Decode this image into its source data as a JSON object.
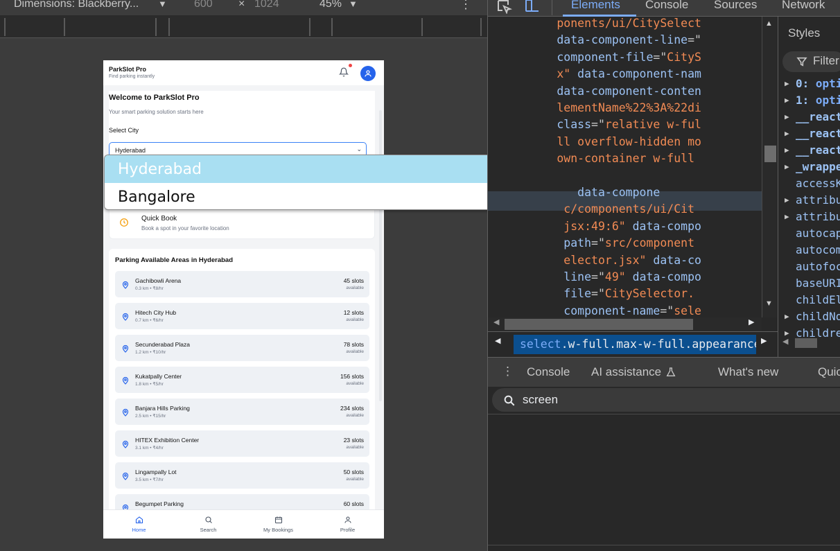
{
  "device_toolbar": {
    "dimensions_label": "Dimensions: Blackberry...",
    "width": "600",
    "times": "×",
    "height": "1024",
    "zoom": "45%"
  },
  "app": {
    "title": "ParkSlot Pro",
    "subtitle": "Find parking instantly",
    "welcome_heading": "Welcome to ParkSlot Pro",
    "welcome_text": "Your smart parking solution starts here",
    "select_city_label": "Select City",
    "selected_city": "Hyderabad",
    "quick_book": {
      "title": "Quick Book",
      "desc": "Book a spot in your favorite location"
    },
    "areas_heading": "Parking Available Areas in Hyderabad",
    "areas": [
      {
        "name": "Gachibowli Arena",
        "meta": "0.3 km • ₹8/hr",
        "slots": "45 slots",
        "avail": "available"
      },
      {
        "name": "Hitech City Hub",
        "meta": "0.7 km • ₹6/hr",
        "slots": "12 slots",
        "avail": "available"
      },
      {
        "name": "Secunderabad Plaza",
        "meta": "1.2 km • ₹10/hr",
        "slots": "78 slots",
        "avail": "available"
      },
      {
        "name": "Kukatpally Center",
        "meta": "1.8 km • ₹5/hr",
        "slots": "156 slots",
        "avail": "available"
      },
      {
        "name": "Banjara Hills Parking",
        "meta": "2.5 km • ₹15/hr",
        "slots": "234 slots",
        "avail": "available"
      },
      {
        "name": "HITEX Exhibition Center",
        "meta": "3.1 km • ₹4/hr",
        "slots": "23 slots",
        "avail": "available"
      },
      {
        "name": "Lingampally Lot",
        "meta": "3.5 km • ₹7/hr",
        "slots": "50 slots",
        "avail": "available"
      },
      {
        "name": "Begumpet Parking",
        "meta": "",
        "slots": "60 slots",
        "avail": ""
      }
    ],
    "nav": {
      "home": "Home",
      "search": "Search",
      "bookings": "My Bookings",
      "profile": "Profile"
    }
  },
  "dropdown_options": [
    "Hyderabad",
    "Bangalore"
  ],
  "devtools": {
    "tabs": {
      "elements": "Elements",
      "console": "Console",
      "sources": "Sources",
      "network": "Network"
    },
    "code_lines": [
      {
        "attr": "",
        "eq": "",
        "val": "ponents/ui/CitySelect",
        "indent": "          "
      },
      {
        "attr": "data-component-line",
        "eq": "=\"",
        "val": "",
        "indent": "          "
      },
      {
        "attr": "component-file",
        "eq": "=\"",
        "val": "CityS",
        "indent": "          "
      },
      {
        "attr": "",
        "eq": "",
        "val": "x\"",
        "tail": " data-component-nam",
        "indent": "          "
      },
      {
        "attr": "data-component-conten",
        "eq": "",
        "val": "",
        "indent": "          "
      },
      {
        "attr": "",
        "eq": "",
        "val": "lementName%22%3A%22di",
        "indent": "          "
      },
      {
        "attr": "class",
        "eq": "=\"",
        "val": "relative w-ful",
        "indent": "          "
      },
      {
        "attr": "",
        "eq": "",
        "val": "ll overflow-hidden mo",
        "indent": "          "
      },
      {
        "attr": "",
        "eq": "",
        "val": "own-container w-full ",
        "indent": "          "
      },
      {
        "attr": "",
        "eq": "",
        "val": "",
        "indent": "          "
      },
      {
        "attr": "data-compone",
        "eq": "",
        "val": "",
        "indent": "             "
      },
      {
        "attr": "",
        "eq": "",
        "val": "c/components/ui/Cit",
        "indent": "           "
      },
      {
        "attr": "",
        "eq": "",
        "val": "jsx:49:6\"",
        "tail": " data-compo",
        "indent": "           "
      },
      {
        "attr": "path",
        "eq": "=\"",
        "val": "src/component",
        "indent": "           "
      },
      {
        "attr": "",
        "eq": "",
        "val": "elector.jsx\"",
        "tail": " data-co",
        "indent": "           "
      },
      {
        "attr": "line",
        "eq": "=\"",
        "val": "49\"",
        "tail": " data-compo",
        "indent": "           "
      },
      {
        "attr": "file",
        "eq": "=\"",
        "val": "CitySelector.",
        "indent": "           "
      },
      {
        "attr": "component-name",
        "eq": "=\"",
        "val": "sele",
        "indent": "           "
      }
    ],
    "breadcrumb": {
      "tag": "select",
      "classes": ".w-full.max-w-full.appearance-none.b"
    },
    "styles_tab": "Styles",
    "filter_placeholder": "Filter",
    "props": [
      {
        "key": "0:",
        "val": " opti",
        "bold": true,
        "arrow": true
      },
      {
        "key": "1:",
        "val": " opti",
        "bold": true,
        "arrow": true
      },
      {
        "key": "__react",
        "val": "",
        "bold": true,
        "arrow": true
      },
      {
        "key": "__react",
        "val": "",
        "bold": true,
        "arrow": true
      },
      {
        "key": "__react",
        "val": "",
        "bold": true,
        "arrow": true
      },
      {
        "key": "_wrappe",
        "val": "",
        "bold": true,
        "arrow": true
      },
      {
        "key": "accessK",
        "val": "",
        "bold": false,
        "arrow": false
      },
      {
        "key": "attribu",
        "val": "",
        "bold": false,
        "arrow": true
      },
      {
        "key": "attribu",
        "val": "",
        "bold": false,
        "arrow": true
      },
      {
        "key": "autocap",
        "val": "",
        "bold": false,
        "arrow": false
      },
      {
        "key": "autocom",
        "val": "",
        "bold": false,
        "arrow": false
      },
      {
        "key": "autofoc",
        "val": "",
        "bold": false,
        "arrow": false
      },
      {
        "key": "baseURI",
        "val": "",
        "bold": false,
        "arrow": false
      },
      {
        "key": "childEl",
        "val": "",
        "bold": false,
        "arrow": false
      },
      {
        "key": "childNo",
        "val": "",
        "bold": false,
        "arrow": true
      },
      {
        "key": "childre",
        "val": "",
        "bold": false,
        "arrow": true
      }
    ],
    "drawer": {
      "console": "Console",
      "ai": "AI assistance",
      "whats_new": "What's new",
      "quick": "Quic",
      "search_value": "screen"
    }
  },
  "colors": {
    "accent": "#2563eb",
    "devtools_accent": "#7cacf8",
    "dropdown_selected": "#a9dff2"
  }
}
